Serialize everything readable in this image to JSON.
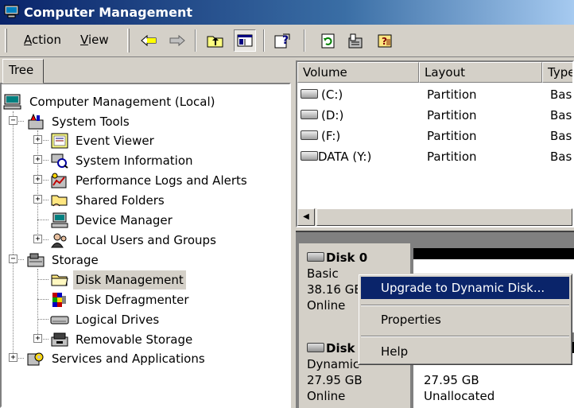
{
  "window": {
    "title": "Computer Management"
  },
  "menu": {
    "action": "Action",
    "view": "View"
  },
  "toolbar_icons": [
    "back-arrow-icon",
    "forward-arrow-icon",
    "up-folder-icon",
    "show-hide-tree-icon",
    "properties-icon",
    "refresh-icon",
    "properties-sheet-icon",
    "help-icon"
  ],
  "tree": {
    "tab_label": "Tree",
    "root": "Computer Management (Local)",
    "system_tools": {
      "label": "System Tools",
      "children": [
        "Event Viewer",
        "System Information",
        "Performance Logs and Alerts",
        "Shared Folders",
        "Device Manager",
        "Local Users and Groups"
      ]
    },
    "storage": {
      "label": "Storage",
      "children": [
        "Disk Management",
        "Disk Defragmenter",
        "Logical Drives",
        "Removable Storage"
      ]
    },
    "services": "Services and Applications",
    "selected": "Disk Management"
  },
  "volumes": {
    "columns": [
      "Volume",
      "Layout",
      "Type"
    ],
    "rows": [
      {
        "volume": "(C:)",
        "layout": "Partition",
        "type": "Basic"
      },
      {
        "volume": "(D:)",
        "layout": "Partition",
        "type": "Basic"
      },
      {
        "volume": "(F:)",
        "layout": "Partition",
        "type": "Basic"
      },
      {
        "volume": "DATA (Y:)",
        "layout": "Partition",
        "type": "Basic"
      }
    ]
  },
  "disks": [
    {
      "name": "Disk 0",
      "type": "Basic",
      "size": "38.16 GB",
      "status": "Online"
    },
    {
      "name": "Disk",
      "type": "Dynamic",
      "size": "27.95 GB",
      "status": "Online",
      "partition_size": "27.95 GB",
      "partition_label": "Unallocated"
    }
  ],
  "context_menu": {
    "items": [
      "Upgrade to Dynamic Disk...",
      "Properties",
      "Help"
    ],
    "highlighted": "Upgrade to Dynamic Disk...",
    "highlight_color": "#0a246a"
  }
}
